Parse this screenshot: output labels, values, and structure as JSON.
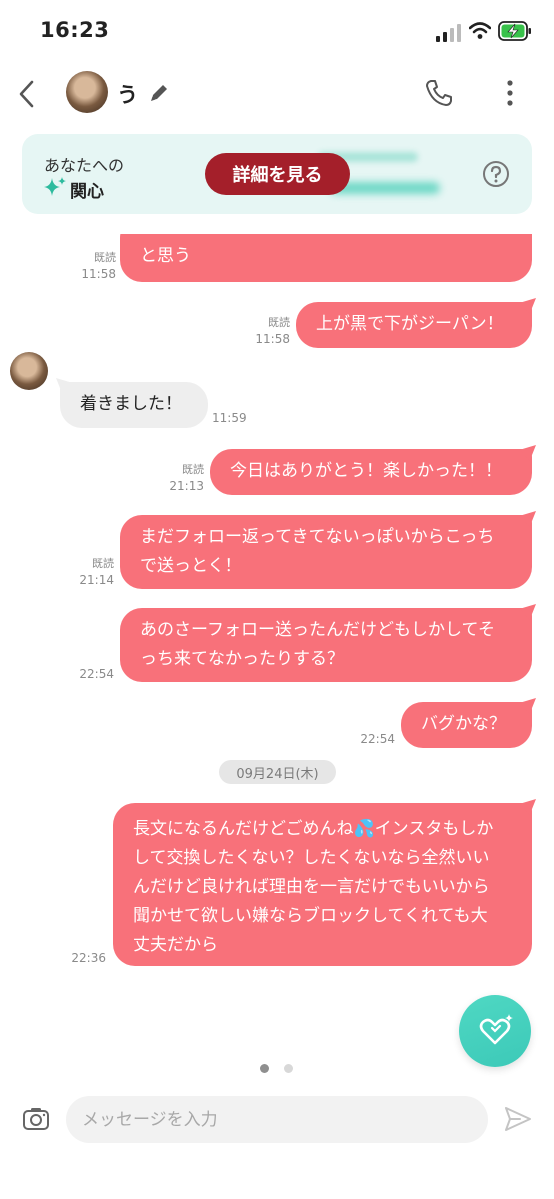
{
  "status_bar": {
    "time": "16:23"
  },
  "header": {
    "contact_name": "う"
  },
  "interest_card": {
    "line1": "あなたへの",
    "line2": "関心",
    "detail_button": "詳細を見る"
  },
  "messages": [
    {
      "text": "と思う",
      "read": "既読",
      "time": "11:58"
    },
    {
      "text": "上が黒で下がジーパン！",
      "read": "既読",
      "time": "11:58"
    },
    {
      "text": "着きました！",
      "time": "11:59"
    },
    {
      "text": "今日はありがとう！楽しかった！！",
      "read": "既読",
      "time": "21:13"
    },
    {
      "line1": "まだフォロー返ってきてないっぽいからこっち",
      "line2": "で送っとく！",
      "read": "既読",
      "time": "21:14"
    },
    {
      "line1": "あのさーフォロー送ったんだけどもしかしてそ",
      "line2": "っち来てなかったりする？",
      "time": "22:54"
    },
    {
      "text": "バグかな？",
      "time": "22:54"
    },
    {
      "line1": "長文になるんだけどごめんね💦インスタもしか",
      "line2": "して交換したくない？したくないなら全然いい",
      "line3": "んだけど良ければ理由を一言だけでもいいから",
      "line4": "聞かせて欲しい嫌ならブロックしてくれても大",
      "line5": "丈夫だから",
      "time": "22:36"
    }
  ],
  "date_separator": "09月24日(木)",
  "input": {
    "placeholder": "メッセージを入力"
  },
  "colors": {
    "my_bubble": "#f8717a",
    "their_bubble": "#eeeeee",
    "accent_teal": "#3cc9b8",
    "detail_button": "#a41f2a"
  }
}
